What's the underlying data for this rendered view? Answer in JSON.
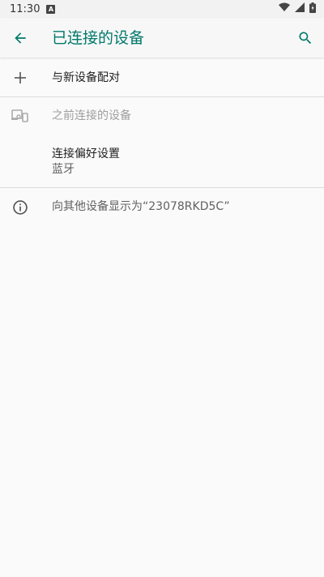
{
  "status_bar": {
    "time": "11:30",
    "notification_icon": "a-icon",
    "icons": [
      "wifi-icon",
      "signal-icon",
      "battery-icon"
    ]
  },
  "app_bar": {
    "title": "已连接的设备",
    "back_icon": "arrow-back-icon",
    "search_icon": "search-icon",
    "accent_color": "#00796b"
  },
  "items": {
    "pair_new": {
      "label": "与新设备配对",
      "icon": "plus-icon"
    },
    "previously_connected": {
      "label": "之前连接的设备",
      "icon": "devices-icon"
    },
    "connection_prefs": {
      "label": "连接偏好设置",
      "summary": "蓝牙"
    },
    "visible_as": {
      "label": "向其他设备显示为“23078RKD5C”",
      "icon": "info-icon"
    }
  }
}
